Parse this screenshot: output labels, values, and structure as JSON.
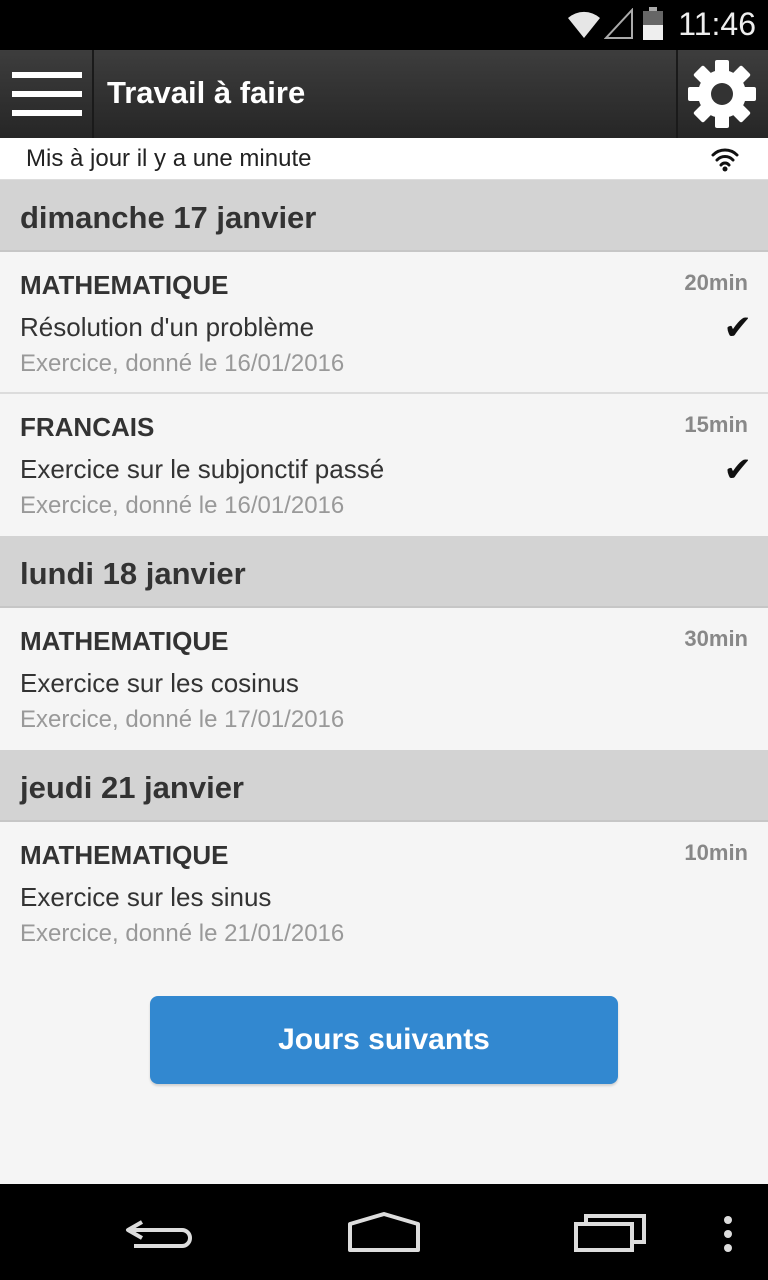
{
  "status_bar": {
    "time": "11:46",
    "icons": [
      "wifi-icon",
      "signal-icon",
      "battery-icon"
    ]
  },
  "app_bar": {
    "title": "Travail à faire",
    "menu_icon": "hamburger-menu-icon",
    "settings_icon": "gear-icon"
  },
  "sync": {
    "text": "Mis à jour il y a une minute",
    "icon": "wifi-icon"
  },
  "days": [
    {
      "label": "dimanche 17 janvier",
      "items": [
        {
          "subject": "MATHEMATIQUE",
          "duration": "20min",
          "task": "Résolution d'un problème",
          "meta": "Exercice, donné le 16/01/2016",
          "done": true
        },
        {
          "subject": "FRANCAIS",
          "duration": "15min",
          "task": "Exercice sur le subjonctif passé",
          "meta": "Exercice, donné le 16/01/2016",
          "done": true
        }
      ]
    },
    {
      "label": "lundi 18 janvier",
      "items": [
        {
          "subject": "MATHEMATIQUE",
          "duration": "30min",
          "task": "Exercice sur les cosinus",
          "meta": "Exercice, donné le 17/01/2016",
          "done": false
        }
      ]
    },
    {
      "label": "jeudi 21 janvier",
      "items": [
        {
          "subject": "MATHEMATIQUE",
          "duration": "10min",
          "task": "Exercice sur les sinus",
          "meta": "Exercice, donné le 21/01/2016",
          "done": false
        }
      ]
    }
  ],
  "next_button": {
    "label": "Jours suivants"
  },
  "colors": {
    "accent": "#3288d0",
    "app_bar": "#2e2e2e",
    "day_header": "#d3d3d3"
  },
  "nav_bar": {
    "icons": [
      "back-icon",
      "home-icon",
      "recent-apps-icon",
      "overflow-menu-icon"
    ]
  }
}
